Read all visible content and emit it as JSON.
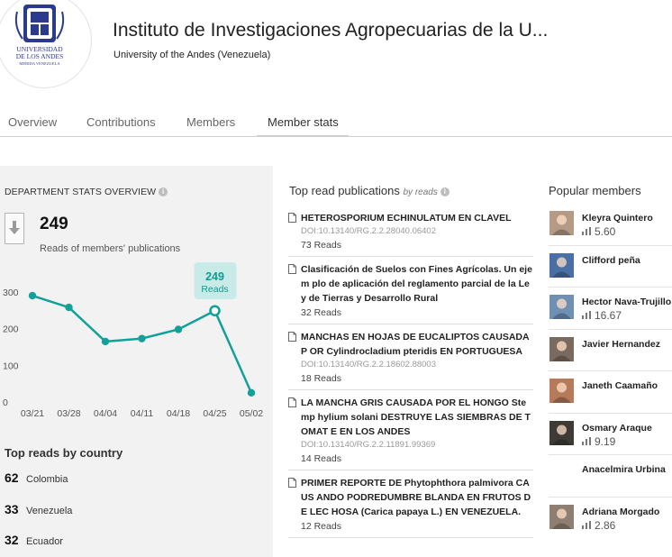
{
  "header": {
    "title": "Instituto de Investigaciones Agropecuarias de la U...",
    "subtitle": "University of the Andes (Venezuela)",
    "logo_text": [
      "UNIVERSIDAD",
      "DE LOS ANDES",
      "MERIDA VENEZUELA"
    ]
  },
  "tabs": [
    {
      "label": "Overview"
    },
    {
      "label": "Contributions"
    },
    {
      "label": "Members"
    },
    {
      "label": "Member stats",
      "active": true
    }
  ],
  "stats": {
    "section_title": "DEPARTMENT STATS OVERVIEW",
    "info_icon": "i",
    "total_reads": "249",
    "total_reads_label": "Reads of members' publications",
    "tooltip_value": "249",
    "tooltip_label": "Reads"
  },
  "chart_data": {
    "type": "line",
    "categories": [
      "03/21",
      "03/28",
      "04/04",
      "04/11",
      "04/18",
      "04/25",
      "05/02"
    ],
    "values": [
      290,
      258,
      165,
      173,
      198,
      249,
      25
    ],
    "ylim": [
      0,
      300
    ],
    "yticks": [
      "300",
      "200",
      "100",
      "0"
    ],
    "highlight_index": 5,
    "color": "#12a19a",
    "grid": false
  },
  "top_reads": {
    "title": "Top reads by country",
    "countries": [
      {
        "count": "62",
        "name": "Colombia"
      },
      {
        "count": "33",
        "name": "Venezuela"
      },
      {
        "count": "32",
        "name": "Ecuador"
      }
    ]
  },
  "publications": {
    "title": "Top read publications",
    "by_label": "by reads",
    "info_icon": "i",
    "items": [
      {
        "title": "HETEROSPORIUM ECHINULATUM EN CLAVEL",
        "doi": "DOI:10.13140/RG.2.2.28040.06402",
        "reads": "73 Reads"
      },
      {
        "title": "Clasificación de Suelos con Fines Agrícolas. Un ejem plo de aplicación del reglamento parcial de la Ley de Tierras y Desarrollo Rural",
        "doi": "",
        "reads": "32 Reads"
      },
      {
        "title": "MANCHAS EN HOJAS DE EUCALIPTOS CAUSADA P OR Cylindrocladium pteridis EN PORTUGUESA",
        "doi": "DOI:10.13140/RG.2.2.18602.88003",
        "reads": "18 Reads"
      },
      {
        "title": "LA MANCHA GRIS CAUSADA POR EL HONGO Stemp hylium solani DESTRUYE LAS SIEMBRAS DE TOMAT E EN LOS ANDES",
        "doi": "DOI:10.13140/RG.2.2.11891.99369",
        "reads": "14 Reads"
      },
      {
        "title": "PRIMER REPORTE DE Phytophthora palmivora CAUS ANDO PODREDUMBRE BLANDA EN FRUTOS DE LEC HOSA (Carica papaya L.) EN VENEZUELA.",
        "doi": "",
        "reads": "12 Reads"
      }
    ]
  },
  "popular": {
    "title": "Popular members",
    "members": [
      {
        "name": "Kleyra Quintero",
        "score": "5.60",
        "avatar_color": "#b59a86"
      },
      {
        "name": "Clifford peña",
        "score": "",
        "avatar_color": "#4a6fa5"
      },
      {
        "name": "Hector Nava-Trujillo",
        "score": "16.67",
        "avatar_color": "#6f8fb3"
      },
      {
        "name": "Javier Hernandez",
        "score": "",
        "avatar_color": "#7a6a5e"
      },
      {
        "name": "Janeth Caamaño",
        "score": "",
        "avatar_color": "#b47a5a"
      },
      {
        "name": "Osmary Araque",
        "score": "9.19",
        "avatar_color": "#3e3a36"
      },
      {
        "name": "Anacelmira Urbina",
        "score": "",
        "avatar_color": "#ffffff"
      },
      {
        "name": "Adriana Morgado",
        "score": "2.86",
        "avatar_color": "#8f7f73"
      }
    ]
  }
}
